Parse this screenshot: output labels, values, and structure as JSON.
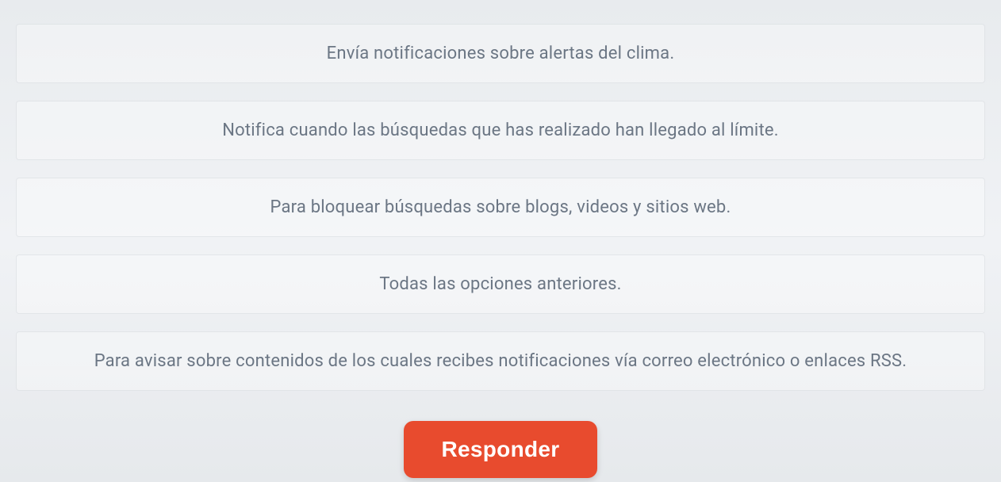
{
  "quiz": {
    "options": [
      "Envía notificaciones sobre alertas del clima.",
      "Notifica cuando las búsquedas que has realizado han llegado al límite.",
      "Para bloquear búsquedas sobre blogs, videos y sitios web.",
      "Todas las opciones anteriores.",
      "Para avisar sobre contenidos de los cuales recibes notificaciones vía correo electrónico o enlaces RSS."
    ],
    "submit_label": "Responder"
  }
}
